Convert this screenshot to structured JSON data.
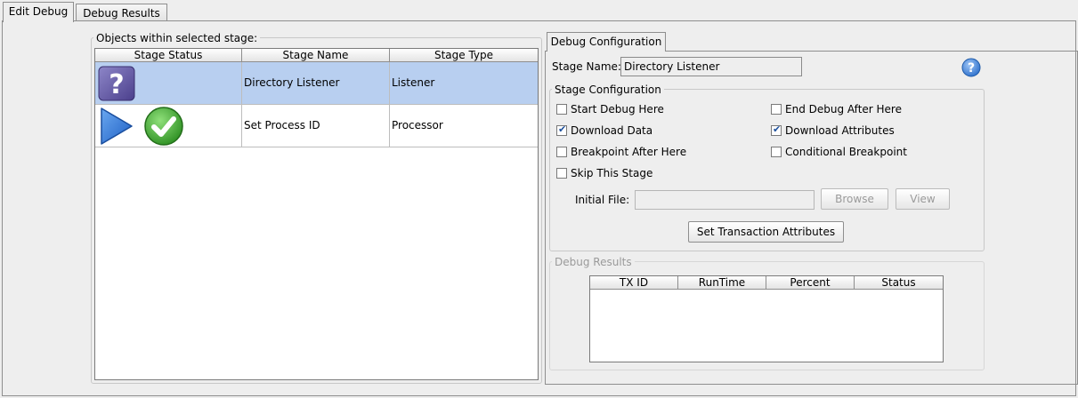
{
  "tabs": [
    {
      "label": "Edit Debug",
      "active": true
    },
    {
      "label": "Debug Results",
      "active": false
    }
  ],
  "objects_group": {
    "title": "Objects within selected stage:",
    "columns": [
      "Stage Status",
      "Stage Name",
      "Stage Type"
    ],
    "rows": [
      {
        "status_icons": [
          "question-icon"
        ],
        "name": "Directory Listener",
        "type": "Listener",
        "selected": true
      },
      {
        "status_icons": [
          "play-icon",
          "check-icon"
        ],
        "name": "Set Process ID",
        "type": "Processor",
        "selected": false
      }
    ]
  },
  "config_tab": {
    "label": "Debug Configuration"
  },
  "stage_name": {
    "label": "Stage Name:",
    "value": "Directory Listener"
  },
  "help_icon": "help-icon",
  "stage_config": {
    "title": "Stage Configuration",
    "options": [
      {
        "label": "Start Debug Here",
        "checked": false
      },
      {
        "label": "End Debug After Here",
        "checked": false
      },
      {
        "label": "Download Data",
        "checked": true
      },
      {
        "label": "Download Attributes",
        "checked": true
      },
      {
        "label": "Breakpoint After Here",
        "checked": false
      },
      {
        "label": "Conditional Breakpoint",
        "checked": false
      },
      {
        "label": "Skip This Stage",
        "checked": false
      }
    ],
    "initial_file": {
      "label": "Initial File:",
      "value": ""
    },
    "browse_label": "Browse",
    "view_label": "View",
    "set_tx_label": "Set Transaction Attributes"
  },
  "debug_results": {
    "title": "Debug Results",
    "columns": [
      "TX ID",
      "RunTime",
      "Percent",
      "Status"
    ]
  },
  "colors": {
    "selection": "#b8cff0",
    "accent": "#1c4f9c",
    "success": "#3ea52e"
  }
}
